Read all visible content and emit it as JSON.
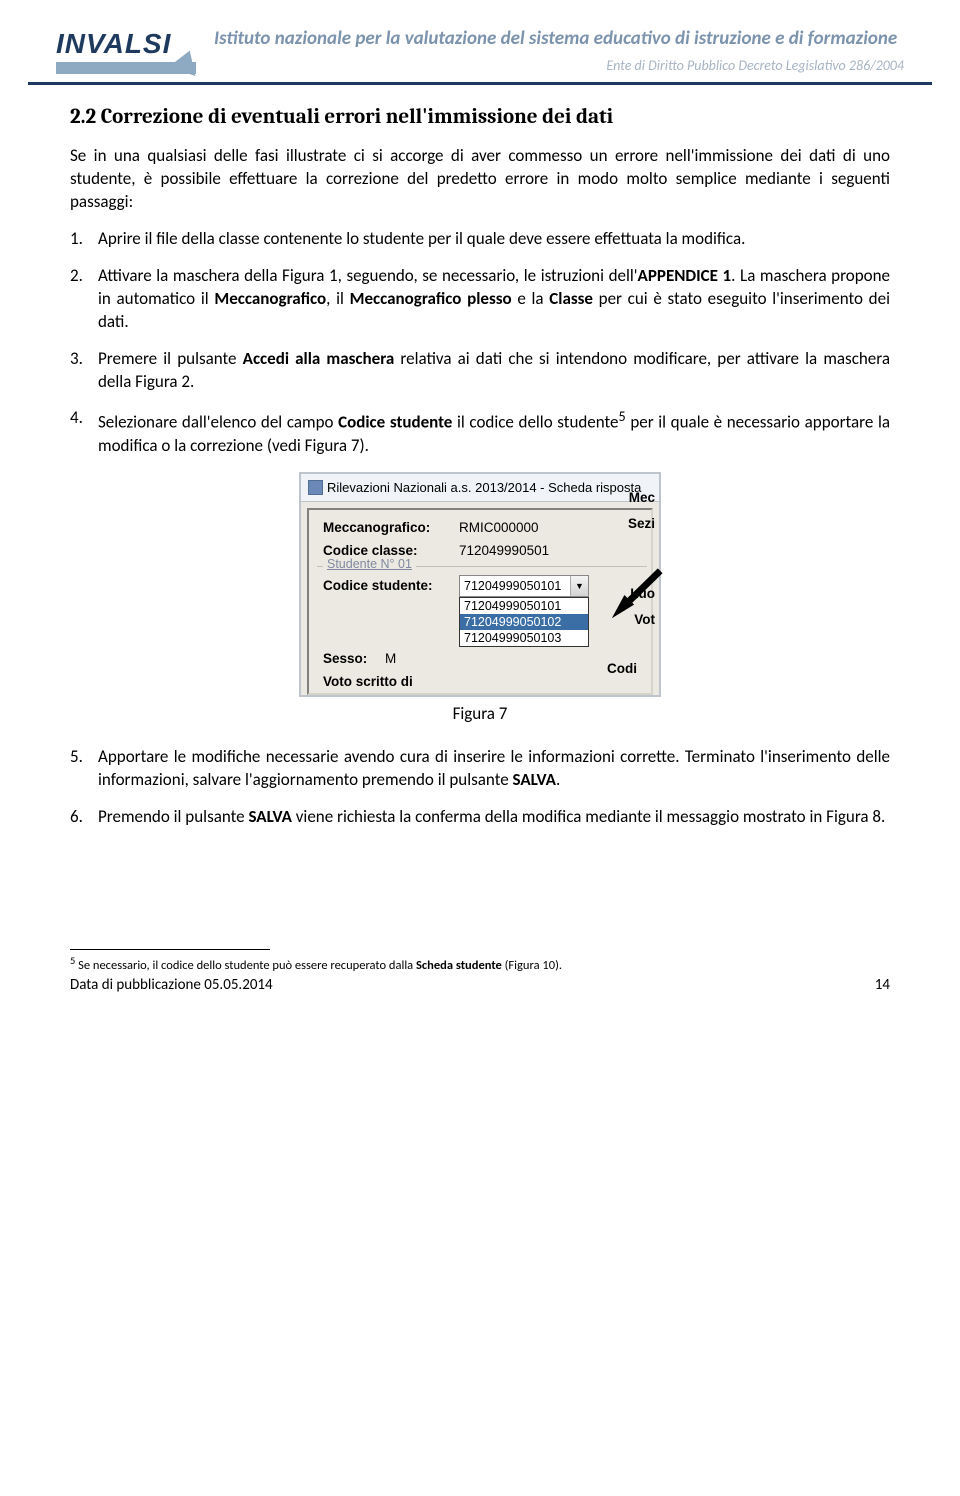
{
  "header": {
    "logo_word": "INVALSI",
    "title": "Istituto nazionale per la valutazione del sistema educativo di istruzione e di formazione",
    "subtitle": "Ente di Diritto Pubblico Decreto Legislativo 286/2004"
  },
  "section": {
    "number": "2.2",
    "title": "2.2 Correzione di eventuali errori nell'immissione dei dati",
    "intro": "Se in una qualsiasi delle fasi illustrate ci si accorge di aver commesso un errore nell'immissione dei dati di uno studente, è possibile effettuare la correzione del predetto errore in modo molto semplice mediante i seguenti passaggi:"
  },
  "steps": [
    "Aprire il file della classe contenente lo studente per il quale deve essere effettuata la modifica.",
    "Attivare la maschera della Figura 1, seguendo, se necessario, le istruzioni dell'<b>APPENDICE 1</b>. La maschera propone in automatico il <b>Meccanografico</b>, il <b>Meccanografico plesso</b> e la <b>Classe</b> per cui è stato eseguito l'inserimento dei dati.",
    "Premere il pulsante <b>Accedi alla maschera</b> relativa ai dati che si intendono modificare, per attivare la maschera della Figura 2.",
    "Selezionare dall'elenco del campo <b>Codice studente</b> il codice dello studente<sup>5</sup> per il quale è necessario apportare la modifica o la correzione (vedi Figura 7).",
    "Apportare le modifiche necessarie avendo cura di inserire le informazioni corrette. Terminato l'inserimento delle informazioni, salvare l'aggiornamento premendo il pulsante <b>SALVA</b>.",
    "Premendo il pulsante <b>SALVA</b> viene richiesta la conferma della modifica mediante il messaggio mostrato in Figura 8."
  ],
  "figure": {
    "caption": "Figura 7",
    "window_title": "Rilevazioni Nazionali a.s. 2013/2014 - Scheda risposta",
    "rows": {
      "mecc_label": "Meccanografico:",
      "mecc_value": "RMIC000000",
      "mecc_right": "Mec",
      "codclasse_label": "Codice classe:",
      "codclasse_value": "712049990501",
      "codclasse_right": "Sezi",
      "group_label": "Studente N° 01",
      "codstud_label": "Codice studente:",
      "codstud_value": "71204999050101",
      "codstud_right": "Codi",
      "sesso_label": "Sesso:",
      "sesso_value": "M",
      "sesso_right": "Luo",
      "voto_label": "Voto scritto di",
      "voto_right": "Vot"
    },
    "dropdown_options": [
      "71204999050101",
      "71204999050102",
      "71204999050103"
    ],
    "dropdown_selected_index": 1
  },
  "footnote": {
    "marker": "5",
    "text": "Se necessario, il codice dello studente può essere recuperato dalla <b>Scheda studente</b> (Figura 10)."
  },
  "footer": {
    "pubdate": "Data di pubblicazione 05.05.2014",
    "page": "14"
  }
}
